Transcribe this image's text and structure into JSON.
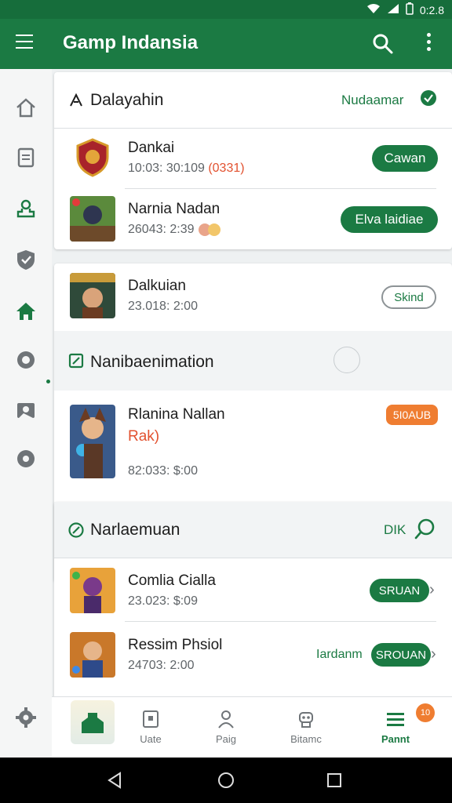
{
  "status": {
    "time": "0:2.8"
  },
  "appbar": {
    "title": "Gamp Indansia"
  },
  "sections": [
    {
      "title": "Dalayahin",
      "action": "Nudaamar",
      "items": [
        {
          "name": "Dankai",
          "meta": "10:03: 30:109",
          "meta_highlight": "(0331)",
          "button": "Cawan"
        },
        {
          "name": "Narnia Nadan",
          "meta": "26043: 2:39",
          "button": "Elva laidiae"
        }
      ]
    },
    {
      "items": [
        {
          "name": "Dalkuian",
          "meta": "23.018: 2:00",
          "button": "Skind"
        }
      ]
    },
    {
      "title": "Nanibaenimation",
      "items": [
        {
          "name": "Rlanina Nallan",
          "subtitle": "Rak)",
          "meta": "82:033: $:00",
          "badge": "5I0AUB"
        }
      ]
    },
    {
      "title": "Narlaemuan",
      "action": "DIK",
      "items": [
        {
          "name": "Comlia Cialla",
          "meta": "23.023: $:09",
          "button": "SRUAN"
        },
        {
          "name": "Ressim Phsiol",
          "meta": "24703: 2:00",
          "prefix": "Iardanm",
          "button": "SROUAN"
        }
      ]
    }
  ],
  "bottom_nav": {
    "items": [
      {
        "label": "Uate"
      },
      {
        "label": "Paig"
      },
      {
        "label": "Bitamc"
      },
      {
        "label": "Pannt"
      }
    ],
    "badge": "10"
  },
  "colors": {
    "primary": "#1b7a43",
    "accent": "#ef7d31",
    "highlight": "#e2512f"
  }
}
